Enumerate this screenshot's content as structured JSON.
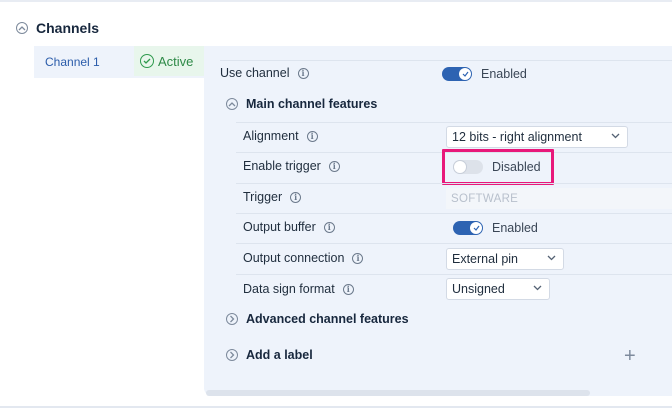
{
  "section": {
    "title": "Channels"
  },
  "side_tab": {
    "label": "Channel 1",
    "status": "Active"
  },
  "rows": {
    "use_channel": {
      "label": "Use channel",
      "toggle_state": "Enabled",
      "on": true
    },
    "main_features": {
      "label": "Main channel features",
      "expanded": true
    },
    "alignment": {
      "label": "Alignment",
      "value": "12 bits - right alignment"
    },
    "enable_trigger": {
      "label": "Enable trigger",
      "toggle_state": "Disabled",
      "on": false
    },
    "trigger": {
      "label": "Trigger",
      "value": "SOFTWARE"
    },
    "output_buffer": {
      "label": "Output buffer",
      "toggle_state": "Enabled",
      "on": true
    },
    "output_connection": {
      "label": "Output connection",
      "value": "External pin"
    },
    "data_sign_format": {
      "label": "Data sign format",
      "value": "Unsigned"
    },
    "advanced_features": {
      "label": "Advanced channel features",
      "expanded": false
    },
    "add_label": {
      "label": "Add a label"
    }
  },
  "colors": {
    "accent": "#2d63b2",
    "active_green": "#2e8a47",
    "highlight": "#e8187a",
    "panel_bg": "#eef3fb"
  },
  "icons": {
    "collapse": "chevron-up-circle-icon",
    "expand": "chevron-right-circle-icon",
    "info": "info-icon",
    "dropdown": "chevron-down-icon",
    "check": "check-circle-icon",
    "add": "plus-icon"
  }
}
